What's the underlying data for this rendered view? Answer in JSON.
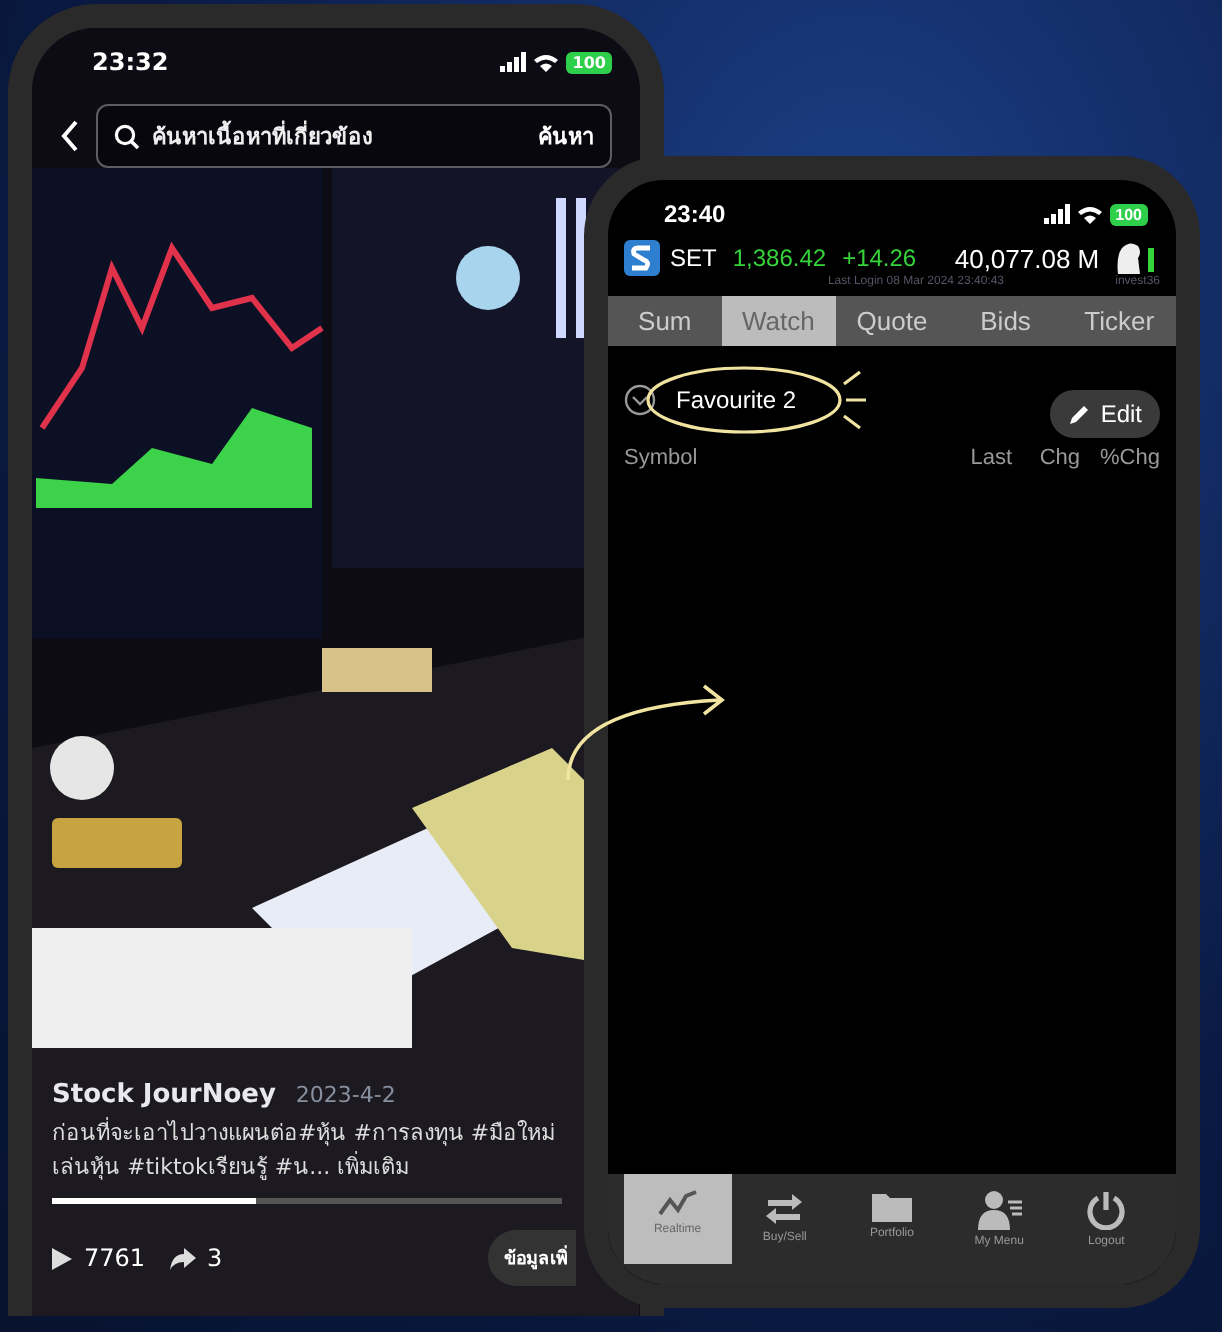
{
  "left_phone": {
    "status": {
      "time": "23:32",
      "battery": "100"
    },
    "search": {
      "placeholder": "ค้นหาเนื้อหาที่เกี่ยวข้อง",
      "button": "ค้นหา"
    },
    "video": {
      "kind": "picture",
      "author": "Stock JourNoey",
      "date": "2023-4-2",
      "caption": "ก่อนที่จะเอาไปวางแผนต่อ#หุ้น #การลงทุน #มือใหม่เล่นหุ้น #tiktokเรียนรู้ #น...",
      "more": "เพิ่มเติม",
      "level": 0.4,
      "plays": "7761",
      "shares": "3",
      "info_button": "ข้อมูลเพิ่"
    }
  },
  "right_phone": {
    "status": {
      "time": "23:40",
      "battery": "100"
    },
    "header": {
      "market": "SET",
      "index": "1,386.42",
      "change": "+14.26",
      "value": "40,077.08 M",
      "last_login": "Last Login 08 Mar 2024 23:40:43",
      "user": "invest36"
    },
    "tabs": [
      {
        "label": "Sum",
        "selected": false
      },
      {
        "label": "Watch",
        "selected": true
      },
      {
        "label": "Quote",
        "selected": false
      },
      {
        "label": "Bids",
        "selected": false
      },
      {
        "label": "Ticker",
        "selected": false
      }
    ],
    "watchlist": {
      "name": "Favourite 2",
      "edit": "Edit"
    },
    "columns": [
      "Symbol",
      "Last",
      "Chg",
      "%Chg"
    ],
    "nav": [
      {
        "kind": "chart",
        "label": "Realtime",
        "selected": true
      },
      {
        "kind": "trade",
        "label": "Buy/Sell",
        "selected": false
      },
      {
        "kind": "folder",
        "label": "Portfolio",
        "selected": false
      },
      {
        "kind": "person",
        "label": "My Menu",
        "selected": false
      },
      {
        "kind": "power",
        "label": "Logout",
        "selected": false
      }
    ]
  }
}
